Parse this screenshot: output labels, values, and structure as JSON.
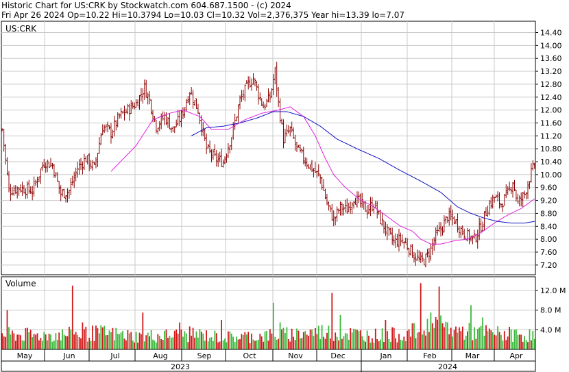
{
  "header": {
    "line1": "Historic Chart for US:CRK by Stockwatch.com 604.687.1500 - (c) 2024",
    "line2": "Fri Apr 26 2024   Op=10.22   Hi=10.3794   Lo=10.03   Cl=10.32   Vol=2,376,375   Year hi=13.39   lo=7.07"
  },
  "colors": {
    "candle": "#8b0000",
    "ma_short": "#e020e0",
    "ma_long": "#1010c0",
    "vol_up": "#3cb83c",
    "vol_down": "#d01818",
    "grid": "#c8c8c8",
    "border": "#000000"
  },
  "chart_data": [
    {
      "type": "ohlc",
      "label": "US:CRK",
      "ylim": [
        6.9,
        14.75
      ],
      "ytick_labels": [
        "7.20",
        "7.60",
        "8.00",
        "8.40",
        "8.80",
        "9.20",
        "9.60",
        "10.00",
        "10.40",
        "10.80",
        "11.20",
        "11.60",
        "12.00",
        "12.40",
        "12.80",
        "13.20",
        "13.60",
        "14.00",
        "14.40"
      ],
      "close_path": [
        [
          0,
          11.4
        ],
        [
          4,
          9.5
        ],
        [
          10,
          9.6
        ],
        [
          18,
          9.5
        ],
        [
          25,
          10.4
        ],
        [
          30,
          10.3
        ],
        [
          35,
          9.4
        ],
        [
          40,
          9.5
        ],
        [
          45,
          10.2
        ],
        [
          50,
          10.5
        ],
        [
          55,
          10.2
        ],
        [
          60,
          11.5
        ],
        [
          65,
          11.3
        ],
        [
          70,
          11.8
        ],
        [
          75,
          12.0
        ],
        [
          80,
          12.2
        ],
        [
          85,
          12.7
        ],
        [
          88,
          12.3
        ],
        [
          92,
          11.5
        ],
        [
          97,
          11.8
        ],
        [
          102,
          11.4
        ],
        [
          107,
          11.8
        ],
        [
          112,
          12.6
        ],
        [
          117,
          12.0
        ],
        [
          122,
          10.8
        ],
        [
          127,
          10.5
        ],
        [
          132,
          10.4
        ],
        [
          137,
          11.2
        ],
        [
          142,
          12.3
        ],
        [
          147,
          12.8
        ],
        [
          150,
          13.0
        ],
        [
          153,
          12.5
        ],
        [
          156,
          12.1
        ],
        [
          160,
          12.4
        ],
        [
          163,
          13.2
        ],
        [
          165,
          12.2
        ],
        [
          168,
          11.1
        ],
        [
          172,
          11.4
        ],
        [
          176,
          10.8
        ],
        [
          180,
          10.5
        ],
        [
          185,
          10.2
        ],
        [
          190,
          9.9
        ],
        [
          194,
          9.1
        ],
        [
          198,
          8.6
        ],
        [
          202,
          9.0
        ],
        [
          206,
          8.9
        ],
        [
          210,
          9.3
        ],
        [
          214,
          9.1
        ],
        [
          218,
          8.9
        ],
        [
          222,
          9.1
        ],
        [
          226,
          8.6
        ],
        [
          230,
          8.2
        ],
        [
          234,
          7.9
        ],
        [
          238,
          8.0
        ],
        [
          242,
          7.8
        ],
        [
          246,
          7.5
        ],
        [
          250,
          7.3
        ],
        [
          253,
          7.4
        ],
        [
          256,
          7.7
        ],
        [
          259,
          8.1
        ],
        [
          262,
          8.3
        ],
        [
          266,
          8.7
        ],
        [
          270,
          8.6
        ],
        [
          274,
          8.3
        ],
        [
          278,
          8.1
        ],
        [
          282,
          8.0
        ],
        [
          286,
          8.4
        ],
        [
          290,
          9.0
        ],
        [
          294,
          9.3
        ],
        [
          298,
          9.1
        ],
        [
          302,
          9.4
        ],
        [
          305,
          9.8
        ],
        [
          308,
          9.1
        ],
        [
          312,
          9.4
        ],
        [
          315,
          9.9
        ],
        [
          318,
          10.32
        ]
      ],
      "ma_short": [
        [
          65,
          10.1
        ],
        [
          80,
          10.9
        ],
        [
          90,
          11.7
        ],
        [
          100,
          11.9
        ],
        [
          108,
          12.0
        ],
        [
          118,
          11.8
        ],
        [
          125,
          11.4
        ],
        [
          135,
          11.4
        ],
        [
          145,
          11.7
        ],
        [
          155,
          11.9
        ],
        [
          165,
          12.0
        ],
        [
          172,
          12.1
        ],
        [
          180,
          11.8
        ],
        [
          187,
          11.2
        ],
        [
          193,
          10.5
        ],
        [
          198,
          10.0
        ],
        [
          205,
          9.6
        ],
        [
          213,
          9.25
        ],
        [
          222,
          9.0
        ],
        [
          230,
          8.7
        ],
        [
          238,
          8.4
        ],
        [
          245,
          8.25
        ],
        [
          250,
          8.0
        ],
        [
          256,
          7.85
        ],
        [
          262,
          7.85
        ],
        [
          270,
          7.95
        ],
        [
          278,
          8.0
        ],
        [
          286,
          8.2
        ],
        [
          294,
          8.5
        ],
        [
          302,
          8.75
        ],
        [
          310,
          8.95
        ],
        [
          318,
          9.25
        ]
      ],
      "ma_long": [
        [
          113,
          11.2
        ],
        [
          122,
          11.45
        ],
        [
          132,
          11.5
        ],
        [
          142,
          11.6
        ],
        [
          152,
          11.75
        ],
        [
          162,
          11.95
        ],
        [
          170,
          11.95
        ],
        [
          180,
          11.8
        ],
        [
          190,
          11.5
        ],
        [
          200,
          11.1
        ],
        [
          212,
          10.8
        ],
        [
          225,
          10.5
        ],
        [
          237,
          10.15
        ],
        [
          250,
          9.8
        ],
        [
          262,
          9.45
        ],
        [
          272,
          9.0
        ],
        [
          280,
          8.8
        ],
        [
          288,
          8.65
        ],
        [
          296,
          8.55
        ],
        [
          304,
          8.5
        ],
        [
          312,
          8.5
        ],
        [
          318,
          8.55
        ]
      ]
    },
    {
      "type": "bar",
      "label": "Volume",
      "ylim": [
        0,
        14.8
      ],
      "ytick_labels": [
        "4.0 M",
        "8.0 M",
        "12.0 M"
      ],
      "unit": "M",
      "vol_path": [
        [
          0,
          3.2
        ],
        [
          20,
          3.0
        ],
        [
          40,
          3.2
        ],
        [
          60,
          3.5
        ],
        [
          80,
          2.8
        ],
        [
          100,
          3.0
        ],
        [
          115,
          3.3
        ],
        [
          130,
          2.6
        ],
        [
          150,
          2.8
        ],
        [
          170,
          3.2
        ],
        [
          190,
          3.8
        ],
        [
          205,
          3.5
        ],
        [
          220,
          3.0
        ],
        [
          240,
          3.2
        ],
        [
          250,
          4.2
        ],
        [
          258,
          5.2
        ],
        [
          270,
          4.0
        ],
        [
          290,
          3.5
        ],
        [
          305,
          3.2
        ],
        [
          318,
          3.0
        ]
      ],
      "vol_spikes": [
        [
          3,
          8.0
        ],
        [
          42,
          13.0
        ],
        [
          48,
          5.5
        ],
        [
          84,
          7.5
        ],
        [
          106,
          5.5
        ],
        [
          131,
          6.0
        ],
        [
          162,
          9.5
        ],
        [
          166,
          5.5
        ],
        [
          197,
          11.5
        ],
        [
          202,
          7.0
        ],
        [
          229,
          6.0
        ],
        [
          250,
          13.5
        ],
        [
          256,
          7.5
        ],
        [
          261,
          12.8
        ],
        [
          266,
          5.5
        ],
        [
          280,
          9.0
        ],
        [
          287,
          6.5
        ]
      ]
    }
  ],
  "x_axis": {
    "months": [
      "May",
      "Jun",
      "Jul",
      "Aug",
      "Sep",
      "Oct",
      "Nov",
      "Dec",
      "Jan",
      "Feb",
      "Mar",
      "Apr"
    ],
    "years": [
      "2023",
      "2024"
    ]
  }
}
